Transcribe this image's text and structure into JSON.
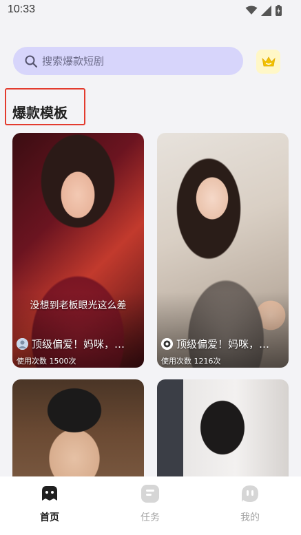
{
  "status_bar": {
    "time": "10:33",
    "icons": [
      "wifi-icon",
      "signal-icon",
      "battery-icon"
    ]
  },
  "search": {
    "placeholder": "搜索爆款短剧",
    "icon": "search-icon"
  },
  "vip_button": {
    "icon": "crown-icon",
    "color": "#f2c200"
  },
  "section": {
    "title": "爆款模板",
    "highlight_color": "#e33b2e"
  },
  "cards": [
    {
      "subtitle": "没想到老板眼光这么差",
      "title": "顶级偏爱！妈咪，…",
      "usage": "使用次数 1500次"
    },
    {
      "subtitle": "",
      "title": "顶级偏爱！妈咪，…",
      "usage": "使用次数 1216次"
    },
    {
      "subtitle": "",
      "title": "",
      "usage": ""
    },
    {
      "subtitle": "",
      "title": "",
      "usage": ""
    }
  ],
  "nav": {
    "items": [
      {
        "label": "首页",
        "icon": "home-icon",
        "active": true
      },
      {
        "label": "任务",
        "icon": "task-icon",
        "active": false
      },
      {
        "label": "我的",
        "icon": "profile-icon",
        "active": false
      }
    ]
  },
  "colors": {
    "search_bg": "#d7d5fb",
    "page_bg": "#f3f3f6",
    "nav_active": "#1a1a1a",
    "nav_inactive": "#a3a3a3"
  }
}
